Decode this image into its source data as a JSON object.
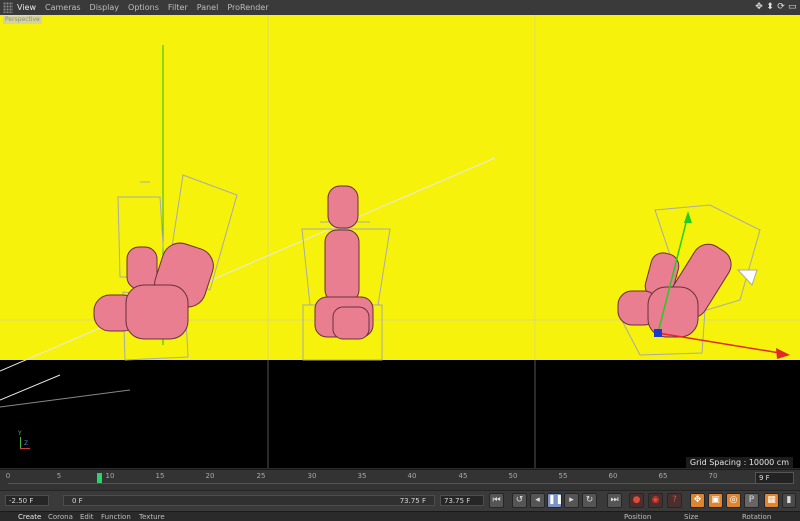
{
  "menu": {
    "items": [
      "View",
      "Cameras",
      "Display",
      "Options",
      "Filter",
      "Panel",
      "ProRender"
    ],
    "active_index": 0
  },
  "viewport": {
    "camera_label": "Perspective",
    "grid_spacing": "Grid Spacing : 10000 cm",
    "background_color": "#f6f20c",
    "floor_color": "#000000",
    "object_color": "#e87e90",
    "axis_labels": {
      "y": "Y",
      "z": "Z"
    }
  },
  "timeline": {
    "ticks": [
      "0",
      "5",
      "10",
      "15",
      "20",
      "25",
      "30",
      "35",
      "40",
      "45",
      "50",
      "55",
      "60",
      "65",
      "70"
    ],
    "current_frame": 8,
    "current_frame_field": "9 F"
  },
  "controls": {
    "start_field": "-2.50 F",
    "range_start": "0 F",
    "range_end": "73.75 F",
    "end_field": "73.75 F",
    "icons": [
      "go-to-start-icon",
      "loop-icon",
      "step-back-icon",
      "pause-icon",
      "step-forward-icon",
      "repeat-icon",
      "go-to-end-icon",
      "record-icon",
      "autokey-icon",
      "help-icon",
      "move-icon",
      "scale-icon",
      "rotate-icon",
      "parameter-icon",
      "grid-icon"
    ]
  },
  "bottom_tabs": {
    "left": [
      "Create",
      "Corona",
      "Edit",
      "Function",
      "Texture"
    ],
    "right": [
      "Position",
      "Size",
      "Rotation"
    ],
    "active": "Create"
  }
}
